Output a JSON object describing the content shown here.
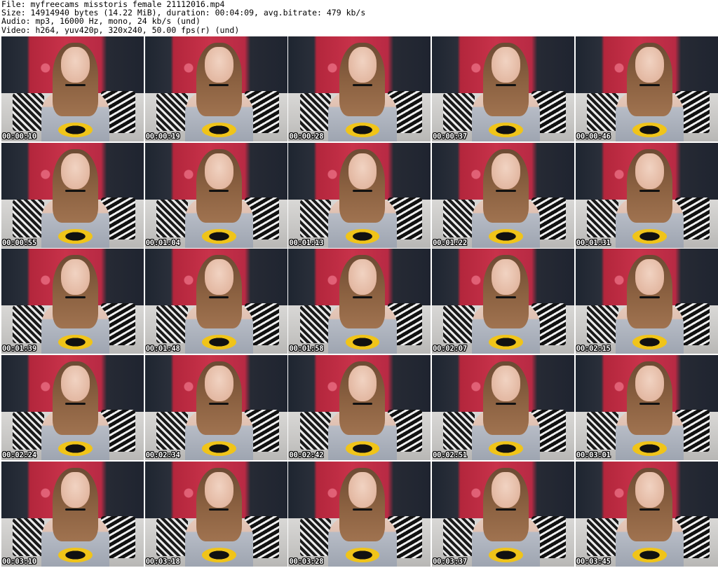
{
  "header": {
    "file_line": "File: myfreecams_misstoris_female_21112016.mp4",
    "size_line": "Size: 14914940 bytes (14.22 MiB), duration: 00:04:09, avg.bitrate: 479 kb/s",
    "audio_line": "Audio: mp3, 16000 Hz, mono, 24 kb/s (und)",
    "video_line": "Video: h264, yuv420p, 320x240, 50.00 fps(r) (und)"
  },
  "thumbnails": [
    {
      "timestamp": "00:00:10"
    },
    {
      "timestamp": "00:00:19"
    },
    {
      "timestamp": "00:00:28"
    },
    {
      "timestamp": "00:00:37"
    },
    {
      "timestamp": "00:00:46"
    },
    {
      "timestamp": "00:00:55"
    },
    {
      "timestamp": "00:01:04"
    },
    {
      "timestamp": "00:01:13"
    },
    {
      "timestamp": "00:01:22"
    },
    {
      "timestamp": "00:01:31"
    },
    {
      "timestamp": "00:01:39"
    },
    {
      "timestamp": "00:01:48"
    },
    {
      "timestamp": "00:01:58"
    },
    {
      "timestamp": "00:02:07"
    },
    {
      "timestamp": "00:02:15"
    },
    {
      "timestamp": "00:02:24"
    },
    {
      "timestamp": "00:02:34"
    },
    {
      "timestamp": "00:02:42"
    },
    {
      "timestamp": "00:02:51"
    },
    {
      "timestamp": "00:03:01"
    },
    {
      "timestamp": "00:03:10"
    },
    {
      "timestamp": "00:03:18"
    },
    {
      "timestamp": "00:03:28"
    },
    {
      "timestamp": "00:03:37"
    },
    {
      "timestamp": "00:03:45"
    }
  ]
}
